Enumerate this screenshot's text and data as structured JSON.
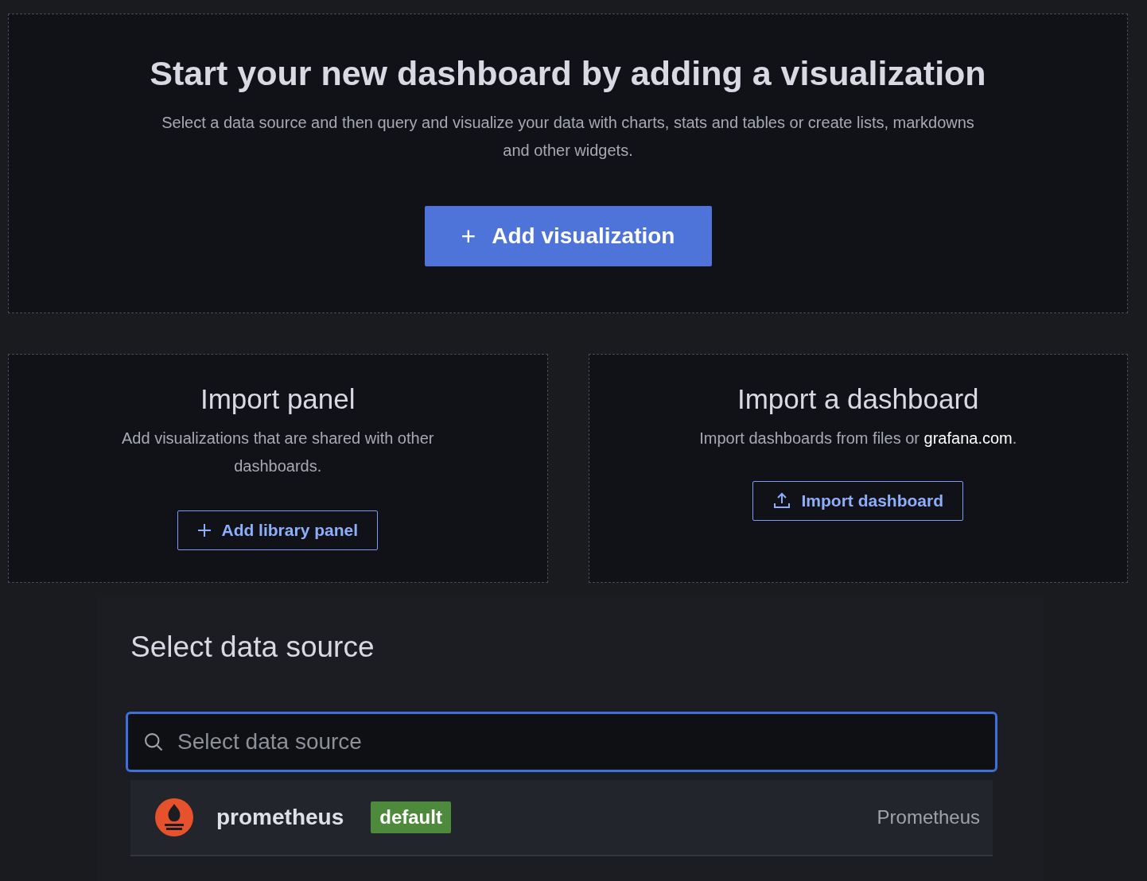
{
  "hero": {
    "title": "Start your new dashboard by adding a visualization",
    "description": "Select a data source and then query and visualize your data with charts, stats and tables or create lists, markdowns and other widgets.",
    "button": {
      "icon": "+",
      "label": "Add visualization"
    }
  },
  "cards": [
    {
      "title": "Import panel",
      "description": "Add visualizations that are shared with other dashboards.",
      "button": {
        "kind": "add",
        "label": "Add library panel"
      }
    },
    {
      "title": "Import a dashboard",
      "description": "Import dashboards from files or ",
      "link": "grafana.com",
      "description_end": ".",
      "button": {
        "kind": "upload",
        "label": "Import dashboard"
      }
    }
  ],
  "modal": {
    "title": "Select data source",
    "search": {
      "placeholder": "Select data source"
    },
    "sources": [
      {
        "name": "prometheus",
        "badge": "default",
        "type": "Prometheus"
      }
    ]
  }
}
